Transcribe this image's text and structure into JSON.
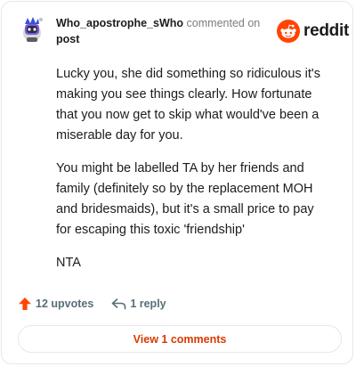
{
  "comment": {
    "username": "Who_apostrophe_sWho",
    "meta_text": "commented on",
    "post_link": "post",
    "paragraphs": [
      "Lucky you, she did something so ridiculous it's making you see things clearly. How fortunate that you now get to skip what would've been a miserable day for you.",
      "You might be labelled TA by her friends and family (definitely so by the replacement MOH and bridesmaids), but it's a small price to pay for escaping this toxic 'friendship'",
      "NTA"
    ]
  },
  "brand": {
    "wordmark": "reddit",
    "icon": "reddit-snoo-icon",
    "color": "#ff4500"
  },
  "actions": {
    "upvotes_label": "12 upvotes",
    "reply_label": "1 reply",
    "upvote_icon": "upvote-arrow-icon",
    "reply_icon": "reply-arrow-icon",
    "upvote_color": "#ff4500"
  },
  "view_button": {
    "label": "View 1 comments",
    "color": "#d93a00"
  }
}
